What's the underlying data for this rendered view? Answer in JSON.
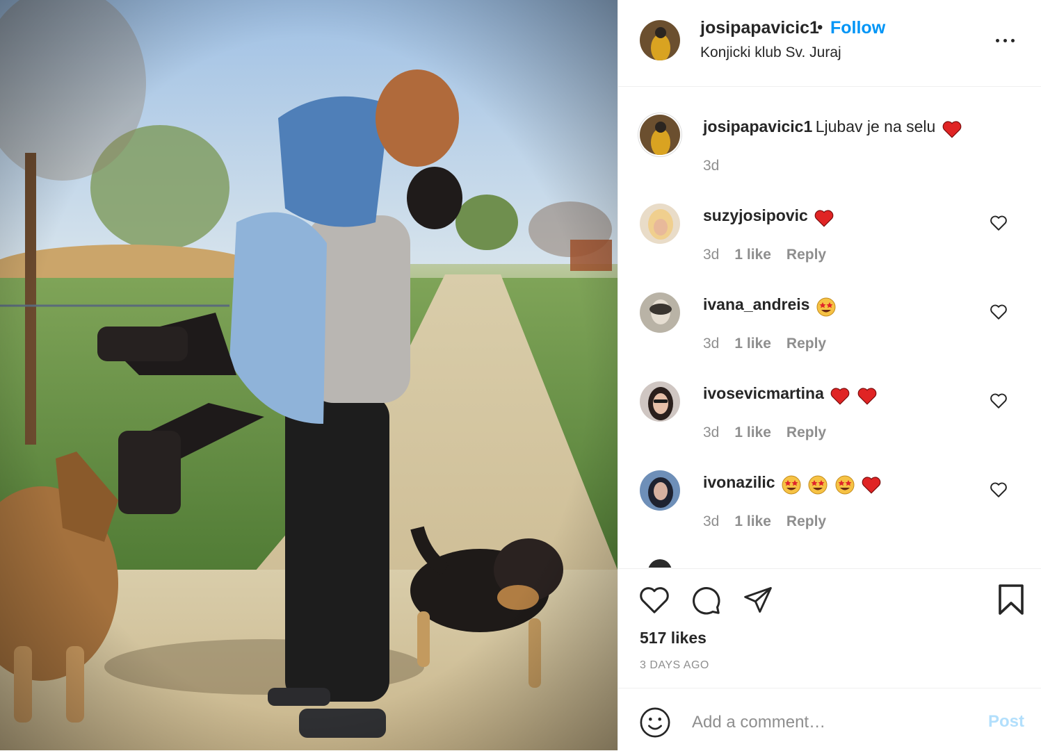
{
  "post": {
    "username": "josipapavicic1",
    "dot": "•",
    "follow_label": "Follow",
    "location": "Konjicki klub Sv. Juraj",
    "caption_user": "josipapavicic1",
    "caption_text": "Ljubav je na selu",
    "caption_time": "3d"
  },
  "comments": [
    {
      "user": "suzyjosipovic",
      "emojis": [
        "heart"
      ],
      "time": "3d",
      "likes": "1 like",
      "reply": "Reply"
    },
    {
      "user": "ivana_andreis",
      "emojis": [
        "star-eyes"
      ],
      "time": "3d",
      "likes": "1 like",
      "reply": "Reply"
    },
    {
      "user": "ivosevicmartina",
      "emojis": [
        "heart",
        "heart"
      ],
      "time": "3d",
      "likes": "1 like",
      "reply": "Reply"
    },
    {
      "user": "ivonazilic",
      "emojis": [
        "star-eyes",
        "star-eyes",
        "star-eyes",
        "heart"
      ],
      "time": "3d",
      "likes": "1 like",
      "reply": "Reply"
    }
  ],
  "footer": {
    "likes_text": "517 likes",
    "date_text": "3 DAYS AGO",
    "comment_placeholder": "Add a comment…",
    "post_label": "Post"
  },
  "icons": [
    "heart-icon",
    "comment-icon",
    "share-icon",
    "bookmark-icon",
    "smiley-icon",
    "more-icon"
  ],
  "colors": {
    "accent": "#0095f6",
    "heart_red": "#ed4956",
    "muted": "#8e8e8e",
    "post_disabled": "#b2dffc"
  }
}
